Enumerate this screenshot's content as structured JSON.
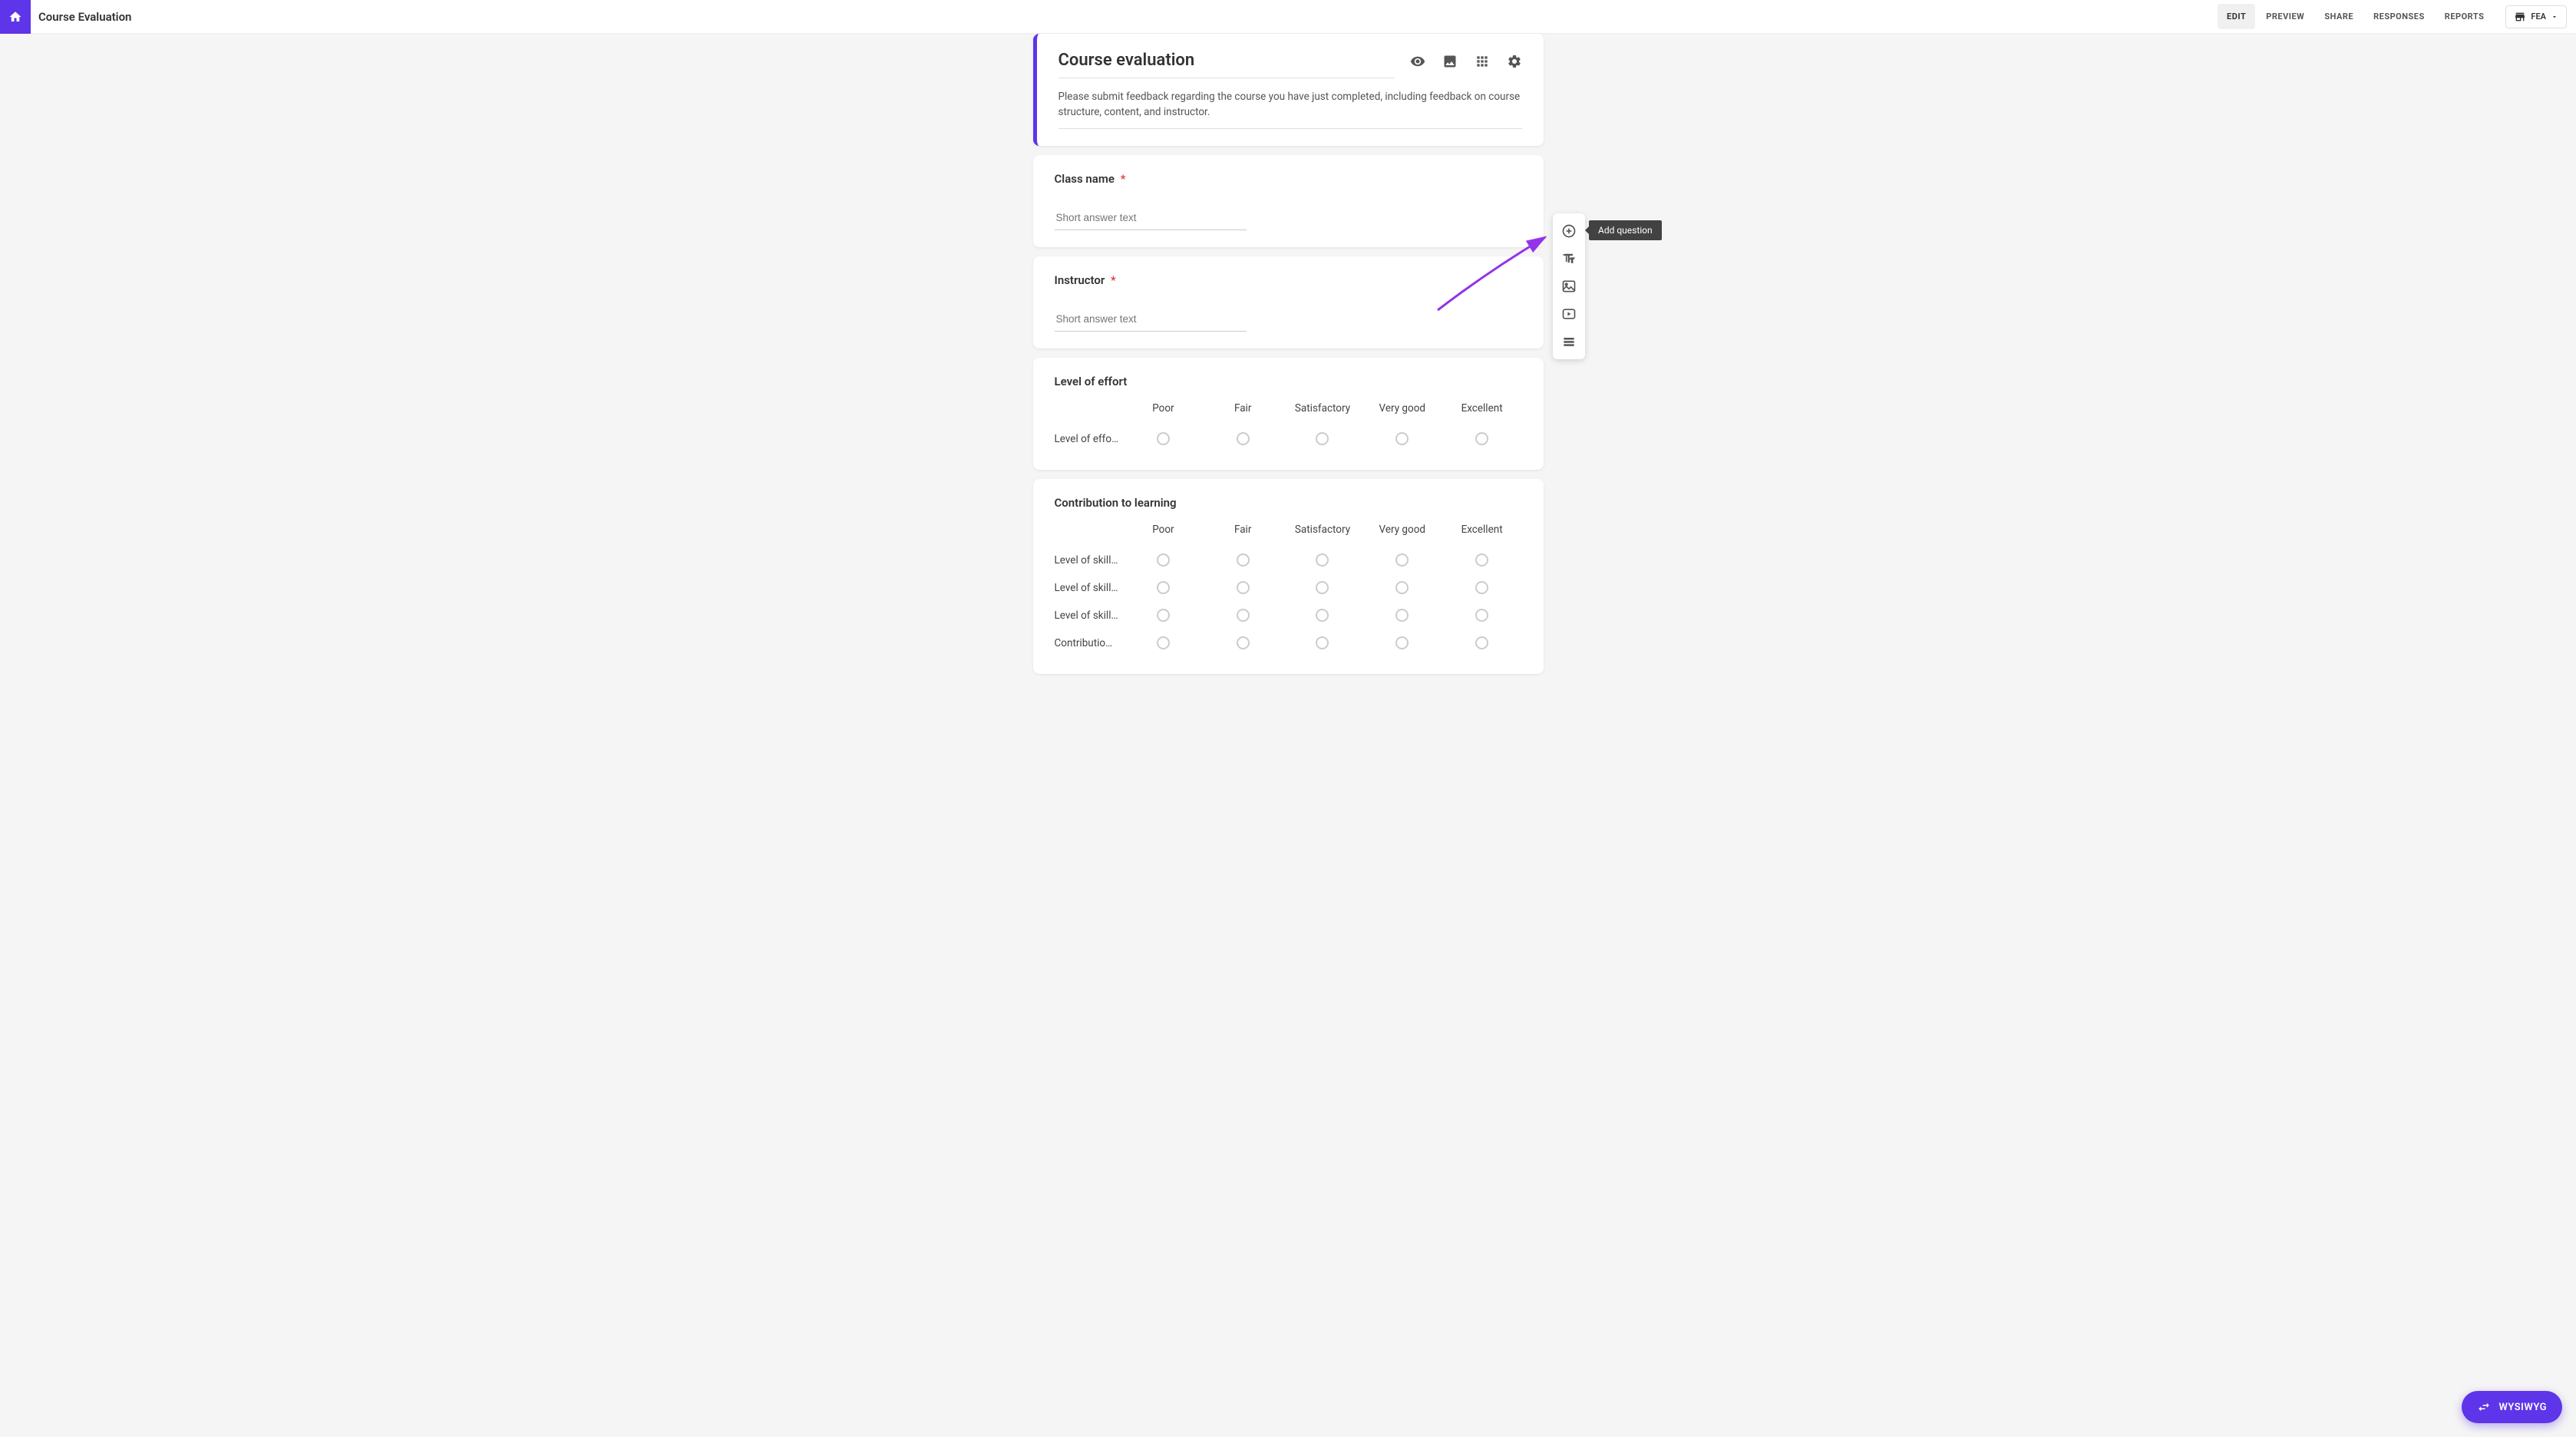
{
  "header": {
    "page_title": "Course Evaluation",
    "nav_tabs": [
      "EDIT",
      "PREVIEW",
      "SHARE",
      "RESPONSES",
      "REPORTS"
    ],
    "active_tab": "EDIT",
    "fea_label": "FEA"
  },
  "form_header": {
    "title": "Course evaluation",
    "description": "Please submit feedback regarding the course you have just completed, including feedback on course structure, content, and instructor."
  },
  "questions": {
    "q1": {
      "title": "Class name",
      "required": true,
      "placeholder": "Short answer text"
    },
    "q2": {
      "title": "Instructor",
      "required": true,
      "placeholder": "Short answer text"
    },
    "q3": {
      "title": "Level of effort",
      "scale_labels": [
        "Poor",
        "Fair",
        "Satisfactory",
        "Very good",
        "Excellent"
      ],
      "rows": [
        "Level of effo…"
      ]
    },
    "q4": {
      "title": "Contribution to learning",
      "scale_labels": [
        "Poor",
        "Fair",
        "Satisfactory",
        "Very good",
        "Excellent"
      ],
      "rows": [
        "Level of skill…",
        "Level of skill…",
        "Level of skill…",
        "Contributio…"
      ]
    }
  },
  "side_toolbar": {
    "tooltip": "Add question",
    "icons": [
      "add-circle",
      "title",
      "image",
      "video",
      "section"
    ]
  },
  "fab": {
    "label": "WYSIWYG"
  },
  "required_marker": "*"
}
